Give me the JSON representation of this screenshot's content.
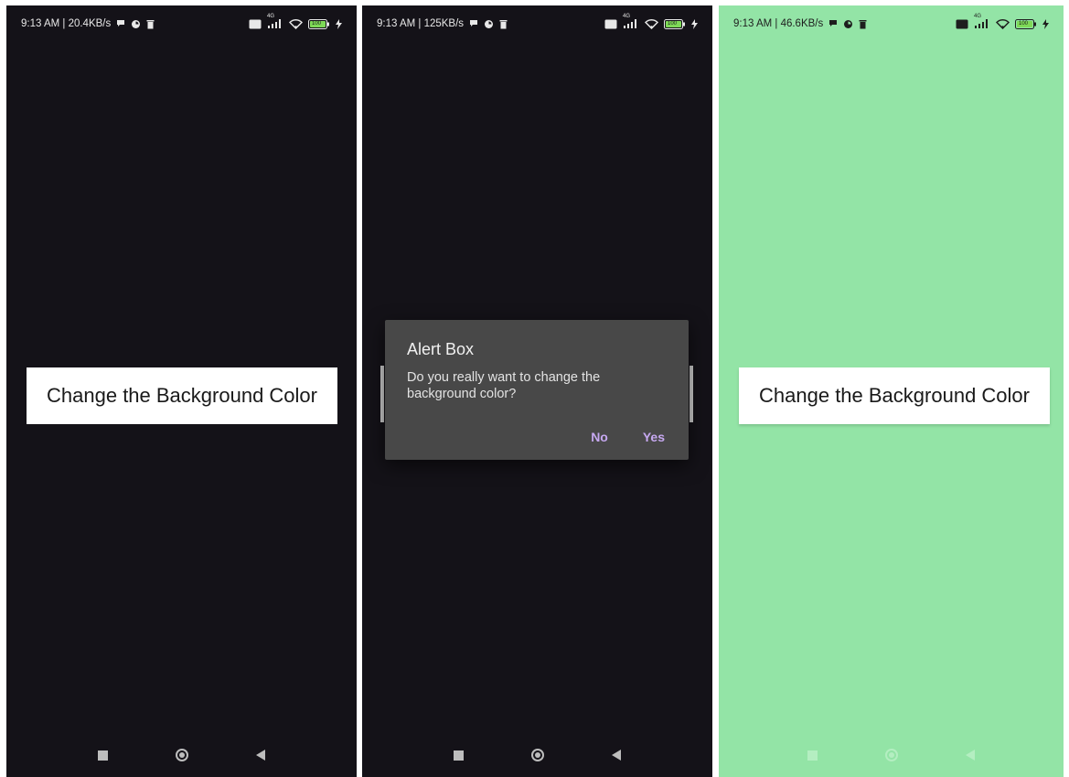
{
  "screens": [
    {
      "status": {
        "time_speed": "9:13 AM | 20.4KB/s",
        "network": "4G",
        "battery": "100"
      },
      "button_label": "Change the Background Color"
    },
    {
      "status": {
        "time_speed": "9:13 AM | 125KB/s",
        "network": "4G",
        "battery": "100"
      },
      "dialog": {
        "title": "Alert Box",
        "message": "Do you really want to change the background color?",
        "no_label": "No",
        "yes_label": "Yes"
      }
    },
    {
      "status": {
        "time_speed": "9:13 AM | 46.6KB/s",
        "network": "4G",
        "battery": "100"
      },
      "button_label": "Change the Background Color"
    }
  ],
  "colors": {
    "dark_background": "#141218",
    "changed_background": "#93e4a6",
    "dialog_background": "#484848",
    "dialog_accent": "#c6a8f0"
  },
  "icons": {
    "status_left": [
      "chat-bubble-icon",
      "pie-app-icon",
      "trash-icon"
    ],
    "status_right": [
      "volte-icon",
      "signal-4g-icon",
      "wifi-icon",
      "battery-icon",
      "charging-bolt-icon"
    ],
    "navigation": [
      "recents-square-icon",
      "home-circle-icon",
      "back-triangle-icon"
    ]
  }
}
